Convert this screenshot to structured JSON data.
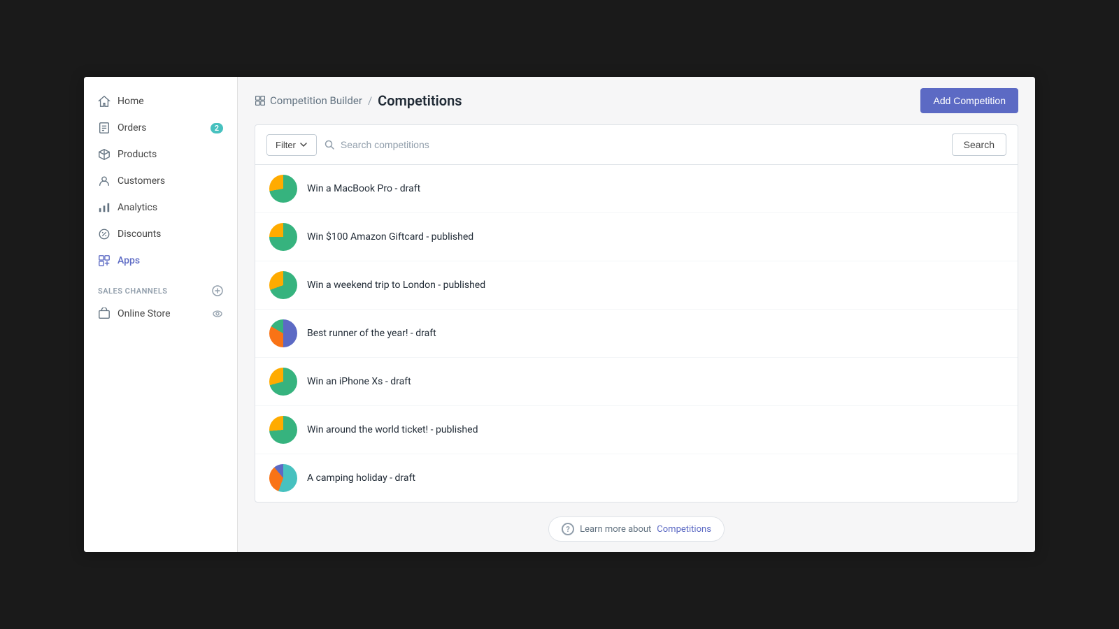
{
  "sidebar": {
    "items": [
      {
        "id": "home",
        "label": "Home",
        "icon": "home",
        "active": false,
        "badge": null
      },
      {
        "id": "orders",
        "label": "Orders",
        "icon": "orders",
        "active": false,
        "badge": "2"
      },
      {
        "id": "products",
        "label": "Products",
        "icon": "products",
        "active": false,
        "badge": null
      },
      {
        "id": "customers",
        "label": "Customers",
        "icon": "customers",
        "active": false,
        "badge": null
      },
      {
        "id": "analytics",
        "label": "Analytics",
        "icon": "analytics",
        "active": false,
        "badge": null
      },
      {
        "id": "discounts",
        "label": "Discounts",
        "icon": "discounts",
        "active": false,
        "badge": null
      },
      {
        "id": "apps",
        "label": "Apps",
        "icon": "apps",
        "active": true,
        "badge": null
      }
    ],
    "sales_channels_label": "SALES CHANNELS",
    "online_store_label": "Online Store"
  },
  "header": {
    "breadcrumb_parent": "Competition Builder",
    "breadcrumb_sep": "/",
    "breadcrumb_current": "Competitions",
    "add_button_label": "Add Competition"
  },
  "search": {
    "filter_label": "Filter",
    "placeholder": "Search competitions",
    "search_button_label": "Search"
  },
  "competitions": [
    {
      "id": 1,
      "title": "Win a MacBook Pro - draft",
      "avatar_type": "green-pie"
    },
    {
      "id": 2,
      "title": "Win $100 Amazon Giftcard - published",
      "avatar_type": "green-pie"
    },
    {
      "id": 3,
      "title": "Win a weekend trip to London - published",
      "avatar_type": "green-pie"
    },
    {
      "id": 4,
      "title": "Best runner of the year! - draft",
      "avatar_type": "blue-mix"
    },
    {
      "id": 5,
      "title": "Win an iPhone Xs - draft",
      "avatar_type": "green-pie"
    },
    {
      "id": 6,
      "title": "Win around the world ticket! - published",
      "avatar_type": "green-pie"
    },
    {
      "id": 7,
      "title": "A camping holiday - draft",
      "avatar_type": "teal-mix"
    }
  ],
  "footer": {
    "learn_more_text": "Learn more about",
    "learn_more_link": "Competitions"
  }
}
